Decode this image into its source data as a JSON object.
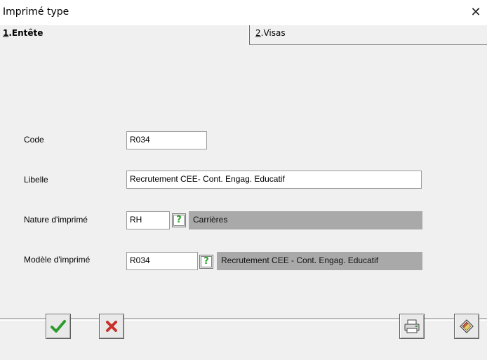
{
  "window": {
    "title": "Imprimé type",
    "close_glyph": "✕"
  },
  "tabs": [
    {
      "key": "1",
      "label": "Entête"
    },
    {
      "key": "2",
      "label": "Visas"
    }
  ],
  "tab_separator": ".",
  "form": {
    "code": {
      "label": "Code",
      "value": "R034"
    },
    "libelle": {
      "label": "Libelle",
      "value": "Recrutement CEE- Cont. Engag. Educatif"
    },
    "nature": {
      "label": "Nature d'imprimé",
      "code": "RH",
      "description": "Carrières"
    },
    "modele": {
      "label": "Modèle d'imprimé",
      "code": "R034",
      "description": "Recrutement CEE - Cont. Engag. Educatif"
    }
  },
  "help_glyph": "?",
  "icons": {
    "ok": "checkmark-icon",
    "cancel": "x-icon",
    "print": "printer-icon",
    "erase": "eraser-icon",
    "help": "question-icon"
  },
  "colors": {
    "ok_green": "#2e9a2e",
    "cancel_red": "#c8322b",
    "help_green": "#2aa52a",
    "readonly_gray": "#a9a9a9"
  }
}
